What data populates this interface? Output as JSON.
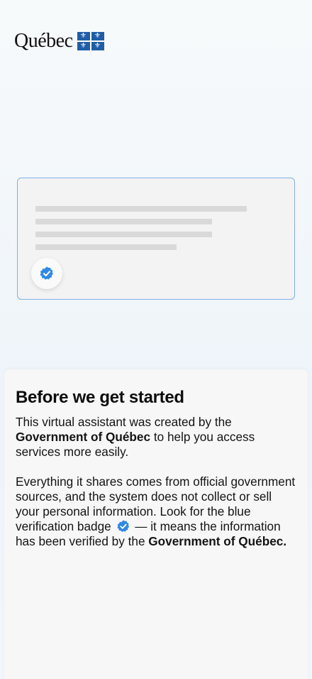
{
  "header": {
    "wordmark": "Québec",
    "flag_symbol": "⚜"
  },
  "preview_card": {
    "border_color": "#7fb1ea",
    "badge_icon": "verified-badge-icon"
  },
  "intro": {
    "title": "Before we get started",
    "p1_before": "This virtual assistant was created by the ",
    "p1_bold": "Government of Québec",
    "p1_after": " to help you access services more easily.",
    "p2_before": "Everything it shares comes from official government sources, and the system does not collect or sell your personal information. Look for the blue verification badge ",
    "p2_after": " — it means the information has been verified by the ",
    "p2_bold": "Government of Québec."
  },
  "colors": {
    "badge_blue": "#2f8ae8",
    "flag_blue": "#1f5da8"
  }
}
